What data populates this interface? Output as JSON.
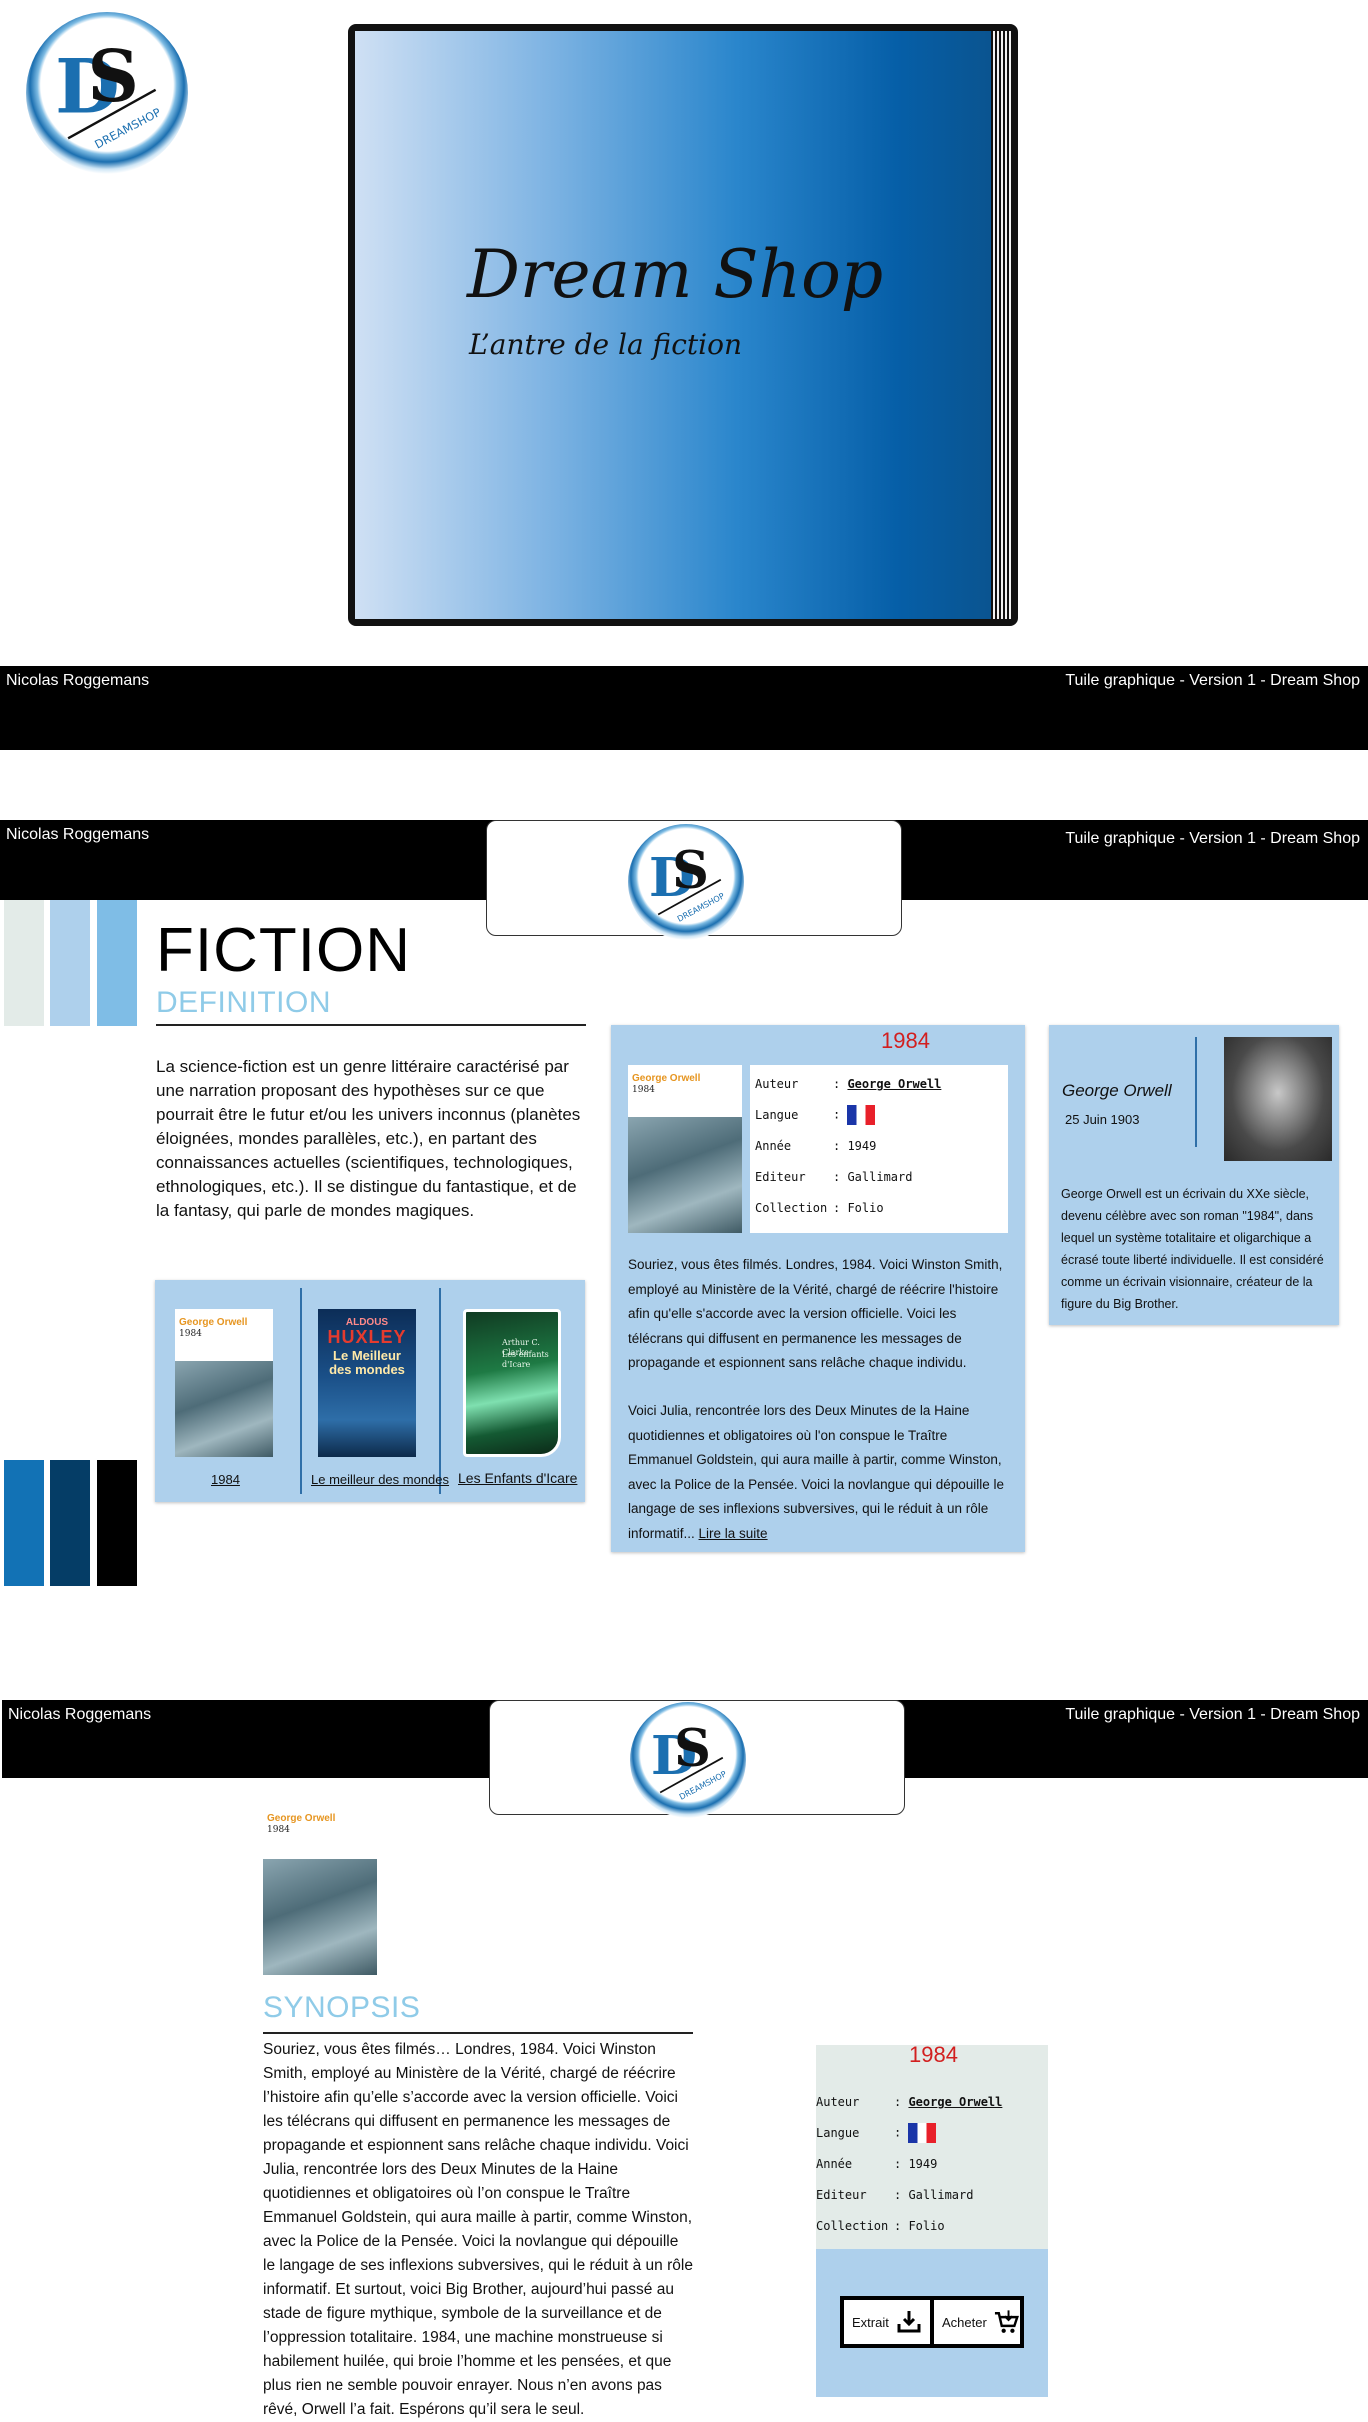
{
  "header": {
    "author": "Nicolas Roggemans",
    "subtitle": "Tuile graphique -  Version 1 - Dream Shop"
  },
  "hero": {
    "title": "Dream Shop",
    "tagline": "L’antre de la fiction"
  },
  "logo": {
    "letters": "DS",
    "text": "DREAMSHOP",
    "icon": "dreamshop-logo"
  },
  "fiction": {
    "title": "FICTION",
    "subtitle": "DEFINITION",
    "paragraph": " La science-fiction est un genre littéraire caractérisé par une narration proposant des hypothèses sur ce que pourrait être le futur et/ou les univers inconnus (planètes éloignées, mondes parallèles, etc.), en partant des connaissances actuelles (scientifiques, technologiques, ethnologiques, etc.). Il se distingue du fantastique, et de la fantasy, qui parle de mondes magiques."
  },
  "swatches": {
    "top": [
      "#e3ebe8",
      "#aed0ec",
      "#7fbde6"
    ],
    "bottom": [
      "#1272b5",
      "#053d66",
      "#000000"
    ]
  },
  "shelf": {
    "books": [
      {
        "label": "1984",
        "cover_author": "George Orwell",
        "cover_year": "1984"
      },
      {
        "label": "Le meilleur des mondes",
        "cover_brand": "ALDOUS",
        "cover_author": "HUXLEY",
        "cover_title": "Le Meilleur des mondes"
      },
      {
        "label": "Les Enfants d'Icare",
        "cover_author": "Arthur C. Clarke",
        "cover_title": "Les enfants d'Icare"
      }
    ]
  },
  "book": {
    "title": "1984",
    "fields": [
      {
        "key": "Auteur",
        "value": "George Orwell"
      },
      {
        "key": "Langue",
        "value": ""
      },
      {
        "key": "Année",
        "value": "1949"
      },
      {
        "key": "Editeur",
        "value": "Gallimard"
      },
      {
        "key": "Collection",
        "value": "Folio"
      }
    ],
    "summary_1": "Souriez, vous êtes filmés. Londres, 1984. Voici Winston Smith, employé au Ministère de la Vérité, chargé de réécrire l'histoire afin qu'elle s'accorde avec la version officielle. Voici les télécrans qui diffusent en permanence les messages de propagande et espionnent sans relâche chaque individu.",
    "summary_2": "Voici Julia, rencontrée lors des Deux Minutes de la Haine quotidiennes et obligatoires où l'on conspue le Traître Emmanuel Goldstein, qui aura maille à partir, comme Winston, avec la Police de la Pensée. Voici la novlangue qui dépouille le langage de ses inflexions subversives, qui le réduit à un rôle informatif... ",
    "read_more": "Lire la suite"
  },
  "author_card": {
    "name": "George Orwell",
    "date": "25 Juin 1903",
    "bio": "George Orwell est un écrivain du XXe siècle, devenu célèbre avec son roman \"1984\", dans lequel un système totalitaire et oligarchique a écrasé toute liberté individuelle. Il est considéré comme un écrivain visionnaire, créateur de la figure du Big Brother."
  },
  "synopsis": {
    "title": "SYNOPSIS",
    "text": "Souriez, vous êtes filmés… Londres, 1984. Voici Winston Smith, employé au Ministère de la Vérité, chargé de réécrire l’histoire afin qu’elle s’accorde avec la version officielle. Voici les télécrans qui diffusent en permanence les messages de propagande et espionnent sans relâche chaque individu. Voici Julia, rencontrée lors des Deux Minutes de la Haine quotidiennes et obligatoires où l’on conspue le Traître Emmanuel Goldstein, qui aura maille à partir, comme Winston, avec la Police de la Pensée. Voici la novlangue qui dépouille le langage de ses inflexions subversives, qui le réduit à un rôle informatif. Et surtout, voici Big Brother, aujourd’hui passé au stade de figure mythique, symbole de la surveillance et de l’oppression totalitaire. 1984, une machine monstrueuse si habilement huilée, qui broie l’homme et les pensées, et que plus rien ne semble pouvoir enrayer. Nous n’en avons pas rêvé, Orwell l’a fait. Espérons qu’il sera le seul."
  },
  "actions": {
    "extract_label": "Extrait",
    "extract_icon": "download-icon",
    "buy_label": "Acheter",
    "buy_icon": "cart-icon"
  }
}
